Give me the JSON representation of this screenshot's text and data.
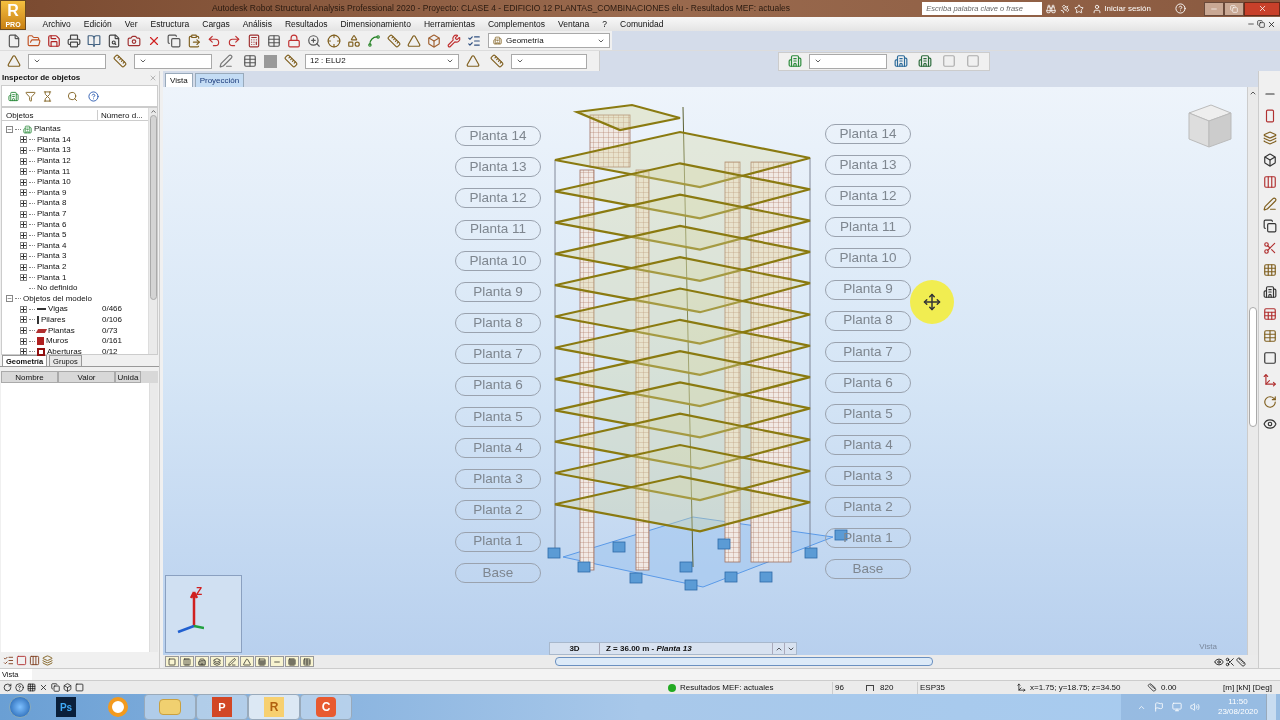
{
  "app": {
    "logo": "R",
    "logo_sub": "PRO",
    "title": "Autodesk Robot Structural Analysis Professional 2020 - Proyecto: CLASE 4 - EDIFICIO 12 PLANTAS_COMBINACIONES elu - Resultados MEF: actuales"
  },
  "search": {
    "placeholder": "Escriba palabra clave o frase"
  },
  "sign_in": "Iniciar sesión",
  "menu": [
    "Archivo",
    "Edición",
    "Ver",
    "Estructura",
    "Cargas",
    "Análisis",
    "Resultados",
    "Dimensionamiento",
    "Herramientas",
    "Complementos",
    "Ventana",
    "?",
    "Comunidad"
  ],
  "toolbar": {
    "view_select": "Geometría",
    "case_select": "12 : ELU2"
  },
  "inspector": {
    "title": "Inspector de objetos",
    "columns": [
      "Objetos",
      "Número d..."
    ],
    "tree": [
      {
        "label": "Plantas",
        "kind": "storeys",
        "expanded": true,
        "children": [
          {
            "label": "Planta 14",
            "expanded": false
          },
          {
            "label": "Planta 13",
            "expanded": false
          },
          {
            "label": "Planta 12",
            "expanded": false
          },
          {
            "label": "Planta 11",
            "expanded": false
          },
          {
            "label": "Planta 10",
            "expanded": false
          },
          {
            "label": "Planta 9",
            "expanded": false
          },
          {
            "label": "Planta 8",
            "expanded": false
          },
          {
            "label": "Planta 7",
            "expanded": false
          },
          {
            "label": "Planta 6",
            "expanded": false
          },
          {
            "label": "Planta 5",
            "expanded": false
          },
          {
            "label": "Planta 4",
            "expanded": false
          },
          {
            "label": "Planta 3",
            "expanded": false
          },
          {
            "label": "Planta 2",
            "expanded": false
          },
          {
            "label": "Planta 1",
            "expanded": false
          },
          {
            "label": "No definido"
          }
        ]
      },
      {
        "label": "Objetos del modelo",
        "expanded": true,
        "children": [
          {
            "label": "Vigas",
            "kind": "beam",
            "count": "0/466",
            "expanded": false
          },
          {
            "label": "Pilares",
            "kind": "column",
            "count": "0/106",
            "expanded": false
          },
          {
            "label": "Plantas",
            "kind": "slab",
            "count": "0/73",
            "expanded": false
          },
          {
            "label": "Muros",
            "kind": "wall",
            "count": "0/161",
            "expanded": false
          },
          {
            "label": "Aberturas",
            "kind": "opening",
            "count": "0/12",
            "expanded": false
          }
        ]
      }
    ],
    "tabs": [
      {
        "label": "Geometría",
        "selected": true
      },
      {
        "label": "Grupos",
        "selected": false
      }
    ],
    "property_columns": [
      "Nombre",
      "Valor",
      "Unida"
    ]
  },
  "view_tabs": [
    {
      "label": "Vista",
      "selected": true
    },
    {
      "label": "Proyección",
      "selected": false
    }
  ],
  "levels_left": [
    "Planta 14",
    "Planta 13",
    "Planta 12",
    "Planta 11",
    "Planta 10",
    "Planta 9",
    "Planta 8",
    "Planta 7",
    "Planta 6",
    "Planta 5",
    "Planta 4",
    "Planta 3",
    "Planta 2",
    "Planta 1",
    "Base"
  ],
  "levels_right": [
    "Planta 14",
    "Planta 13",
    "Planta 12",
    "Planta 11",
    "Planta 10",
    "Planta 9",
    "Planta 8",
    "Planta 7",
    "Planta 6",
    "Planta 5",
    "Planta 4",
    "Planta 3",
    "Planta 2",
    "Planta 1",
    "Base"
  ],
  "axis_label": "Z",
  "view_bar": {
    "mode": "3D",
    "level": "Z = 36.00 m - *Planta 13*",
    "hint": "Vista"
  },
  "command": {
    "value": "Vista"
  },
  "status": {
    "message": "Resultados MEF: actuales",
    "ok": true,
    "nodes": "96",
    "elements": "820",
    "section": "ESP35",
    "coords": "x=1.75; y=18.75; z=34.50",
    "angle": "0.00",
    "units": "[m] [kN] [Deg]"
  },
  "taskbar": [
    {
      "kind": "start"
    },
    {
      "kind": "photoshop",
      "label": "Ps"
    },
    {
      "kind": "orange"
    },
    {
      "kind": "folder"
    },
    {
      "kind": "powerpoint",
      "label": "P"
    },
    {
      "kind": "robot",
      "label": "R"
    },
    {
      "kind": "camtasia",
      "label": "C"
    }
  ],
  "clock": {
    "time": "11:50",
    "date": "23/08/2020"
  }
}
